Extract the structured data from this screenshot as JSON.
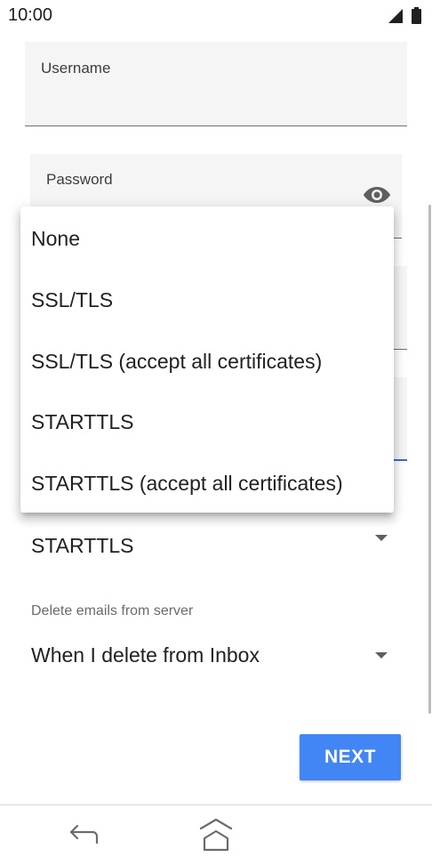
{
  "status_bar": {
    "time": "10:00"
  },
  "form": {
    "username_label": "Username",
    "password_label": "Password",
    "security": {
      "value": "STARTTLS"
    },
    "delete_emails": {
      "label": "Delete emails from server",
      "value": "When I delete from Inbox"
    }
  },
  "menu": {
    "items": [
      {
        "label": "None"
      },
      {
        "label": "SSL/TLS"
      },
      {
        "label": "SSL/TLS (accept all certificates)"
      },
      {
        "label": "STARTTLS"
      },
      {
        "label": "STARTTLS (accept all certificates)"
      }
    ]
  },
  "buttons": {
    "next_label": "NEXT"
  },
  "icons": {
    "signal": "signal-icon",
    "battery": "battery-icon",
    "password_toggle": "eye-icon",
    "back": "back-icon",
    "home": "home-icon"
  },
  "colors": {
    "accent": "#4285f4",
    "focus_underline": "#2f6ad9"
  }
}
